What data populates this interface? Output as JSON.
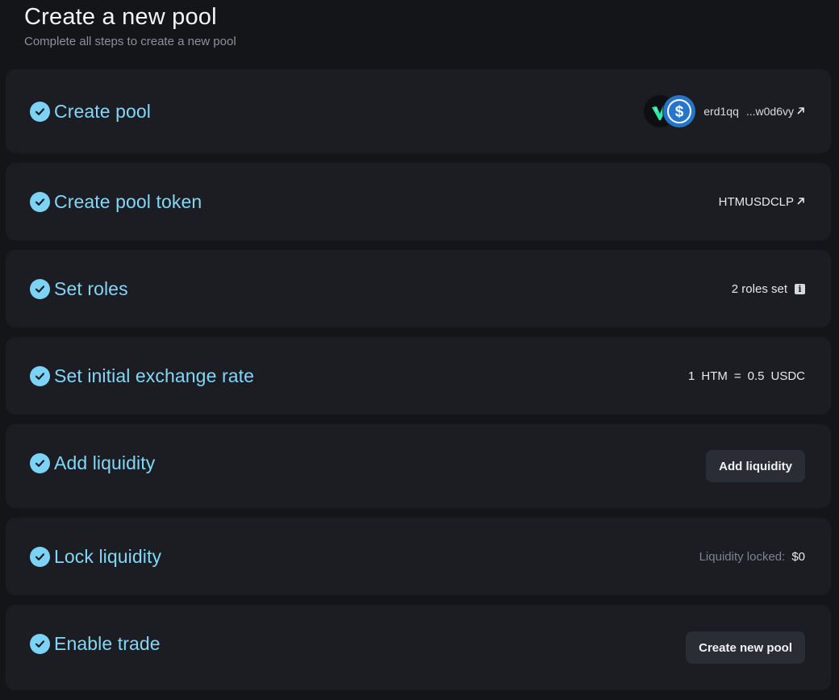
{
  "header": {
    "title": "Create a new pool",
    "subtitle": "Complete all steps to create a new pool"
  },
  "steps": {
    "create_pool": {
      "title": "Create pool",
      "completed": true,
      "tokens": [
        "htm-token-icon",
        "usdc-token-icon"
      ],
      "address_start": "erd1qq",
      "address_end": "...w0d6vy"
    },
    "create_pool_token": {
      "title": "Create pool token",
      "completed": true,
      "token_id": "HTMUSDCLP"
    },
    "set_roles": {
      "title": "Set roles",
      "completed": true,
      "status": "2 roles set"
    },
    "set_exchange_rate": {
      "title": "Set initial exchange rate",
      "completed": true,
      "base_amount": "1",
      "base_token": "HTM",
      "equals": "=",
      "quote_amount": "0.5",
      "quote_token": "USDC"
    },
    "add_liquidity": {
      "title": "Add liquidity",
      "completed": true,
      "button_label": "Add liquidity"
    },
    "lock_liquidity": {
      "title": "Lock liquidity",
      "completed": true,
      "locked_label": "Liquidity locked:",
      "locked_value": "$0"
    },
    "enable_trade": {
      "title": "Enable trade",
      "completed": true,
      "button_label": "Create new pool"
    }
  },
  "colors": {
    "background": "#131519",
    "card": "#1b1d23",
    "accent": "#7dd3f6",
    "button": "#2a2d34",
    "usdc": "#2775ca",
    "htm": "#2ee6a6"
  }
}
